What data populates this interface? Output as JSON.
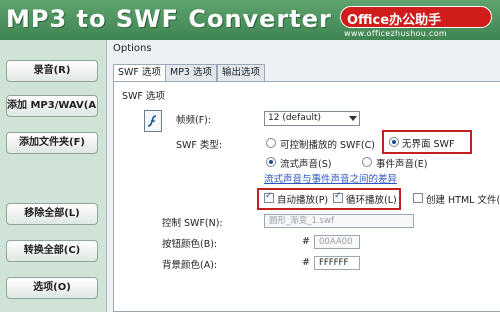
{
  "app": {
    "title": "MP3 to SWF Converter"
  },
  "logo": {
    "text": "Office办公助手",
    "url": "www.officezhushou.com"
  },
  "sidebar": {
    "buttons": [
      {
        "label": "录音(R)"
      },
      {
        "label": "添加 MP3/WAV(A)"
      },
      {
        "label": "添加文件夹(F)"
      },
      {
        "label": "移除全部(L)"
      },
      {
        "label": "转换全部(C)"
      },
      {
        "label": "选项(O)"
      }
    ]
  },
  "options": {
    "title": "Options",
    "tabs": [
      {
        "label": "SWF 选项",
        "active": true
      },
      {
        "label": "MP3 选项",
        "active": false
      },
      {
        "label": "输出选项",
        "active": false
      }
    ],
    "section": "SWF 选项",
    "frame_rate": {
      "label": "帧频(F):",
      "value": "12 (default)"
    },
    "swf_type": {
      "label": "SWF 类型:",
      "option_controllable": "可控制播放的 SWF(C)",
      "option_no_ui": "无界面 SWF",
      "selected": "无界面 SWF"
    },
    "sound": {
      "option_stream": "流式声音(S)",
      "option_event": "事件声音(E)",
      "selected": "流式声音(S)",
      "difference_link": "流式声音与事件声音之间的差异"
    },
    "checkboxes": {
      "autoplay": {
        "label": "自动播放(P)",
        "checked": true
      },
      "loop": {
        "label": "循环播放(L)",
        "checked": true
      },
      "html": {
        "label": "创建 HTML 文件(H)",
        "checked": false
      }
    },
    "control_swf": {
      "label": "控制 SWF(N):",
      "value": "圆形_渐变_1.swf"
    },
    "button_color": {
      "label": "按钮颜色(B):",
      "hash": "#",
      "value": "00AA00"
    },
    "bg_color": {
      "label": "背景颜色(A):",
      "hash": "#",
      "value": "FFFFFF"
    }
  },
  "colors": {
    "accent": "#3f8552",
    "highlight": "#c42020",
    "link": "#2a55c0"
  }
}
